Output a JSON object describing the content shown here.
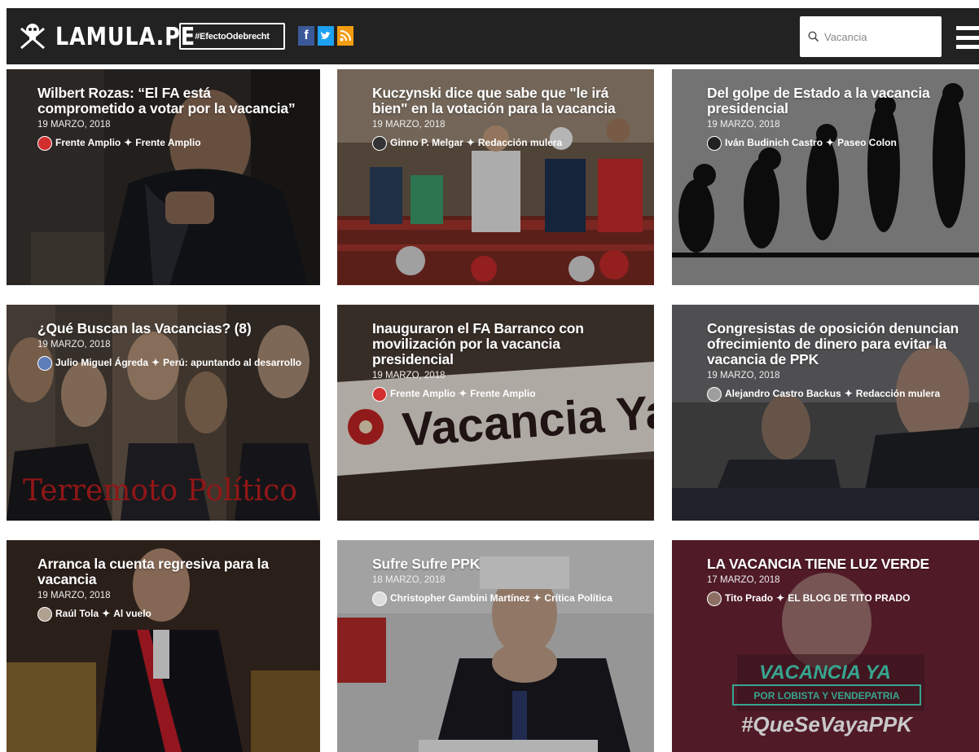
{
  "header": {
    "logo_text": "LAMULA.PE",
    "tag_button": "#EfectoOdebrecht",
    "social": [
      {
        "name": "facebook",
        "glyph": "f",
        "color": "#3b5998"
      },
      {
        "name": "twitter",
        "glyph": "t",
        "color": "#1da1f2"
      },
      {
        "name": "rss",
        "glyph": "◣",
        "color": "#f39c12"
      }
    ],
    "search": {
      "placeholder": "Vacancia",
      "value": ""
    }
  },
  "articles": [
    {
      "title": "Wilbert Rozas: “El FA está comprometido a votar por la vacancia”",
      "date": "19 MARZO, 2018",
      "author": "Frente Amplio",
      "blog": "Frente Amplio",
      "avatar_color": "#d32f2f"
    },
    {
      "title": "Kuczynski dice que sabe que \"le irá bien\" en la votación para la vacancia",
      "date": "19 MARZO, 2018",
      "author": "Ginno P. Melgar",
      "blog": "Redacción mulera",
      "avatar_color": "#333333"
    },
    {
      "title": "Del golpe de Estado a la vacancia presidencial",
      "date": "19 MARZO, 2018",
      "author": "Iván Budinich Castro",
      "blog": "Paseo Colon",
      "avatar_color": "#222222"
    },
    {
      "title": "¿Qué Buscan las Vacancias? (8)",
      "date": "19 MARZO, 2018",
      "author": "Julio Miguel Ágreda",
      "blog": "Perú: apuntando al desarrollo",
      "avatar_color": "#5c7db8"
    },
    {
      "title": "Inauguraron el FA Barranco con movilización por la vacancia presidencial",
      "date": "19 MARZO, 2018",
      "author": "Frente Amplio",
      "blog": "Frente Amplio",
      "avatar_color": "#d32f2f"
    },
    {
      "title": "Congresistas de oposición denuncian ofrecimiento de dinero para evitar la vacancia de PPK",
      "date": "19 MARZO, 2018",
      "author": "Alejandro Castro Backus",
      "blog": "Redacción mulera",
      "avatar_color": "#9e9e9e"
    },
    {
      "title": "Arranca la cuenta regresiva para la vacancia",
      "date": "19 MARZO, 2018",
      "author": "Raúl Tola",
      "blog": "Al vuelo",
      "avatar_color": "#b0a090"
    },
    {
      "title": "Sufre Sufre PPK",
      "date": "18 MARZO, 2018",
      "author": "Christopher Gambini Martínez",
      "blog": "Crítica Política",
      "avatar_color": "#dddddd"
    },
    {
      "title": "LA VACANCIA TIENE LUZ VERDE",
      "date": "17 MARZO, 2018",
      "author": "Tito Prado",
      "blog": "EL BLOG DE TITO PRADO",
      "avatar_color": "#8d6e63"
    }
  ],
  "image_texts": {
    "card5_banner": "Vacancia Ya",
    "card4_overlay": "Terremoto Político",
    "card9_line1": "VACANCIA YA",
    "card9_line2": "POR LOBISTA Y VENDEPATRIA",
    "card9_line3": "#QueSeVayaPPK"
  }
}
